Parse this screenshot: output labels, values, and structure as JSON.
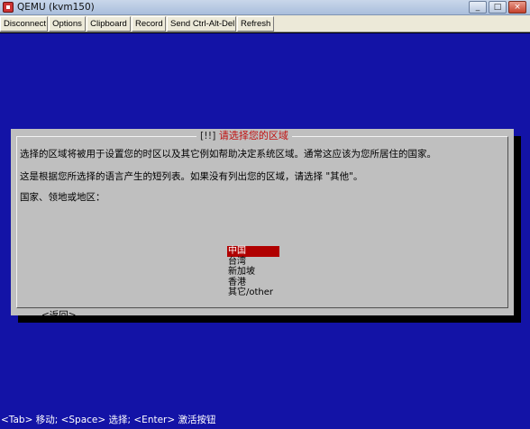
{
  "window": {
    "title": "QEMU (kvm150)",
    "controls": [
      "_",
      "□",
      "×"
    ]
  },
  "toolbar": {
    "disconnect": "Disconnect",
    "options": "Options",
    "clipboard": "Clipboard",
    "record": "Record",
    "send_cad": "Send Ctrl-Alt-Del",
    "refresh": "Refresh"
  },
  "dialog": {
    "title_open": "[!!]",
    "title_text": "请选择您的区域",
    "description_line1": "选择的区域将被用于设置您的时区以及其它例如帮助决定系统区域。通常这应该为您所居住的国家。",
    "description_line2": "这是根据您所选择的语言产生的短列表。如果没有列出您的区域，请选择 \"其他\"。",
    "field_label": "国家、领地或地区：",
    "options": [
      "中国",
      "台湾",
      "新加坡",
      "香港",
      "其它/other"
    ],
    "selected_index": 0,
    "back_label": "<返回>"
  },
  "status_line": "<Tab> 移动; <Space> 选择; <Enter> 激活按钮",
  "colors": {
    "console_bg": "#1313a6",
    "dialog_bg": "#bfbfbf",
    "title_color": "#c01010",
    "selection_bg": "#b00000"
  }
}
